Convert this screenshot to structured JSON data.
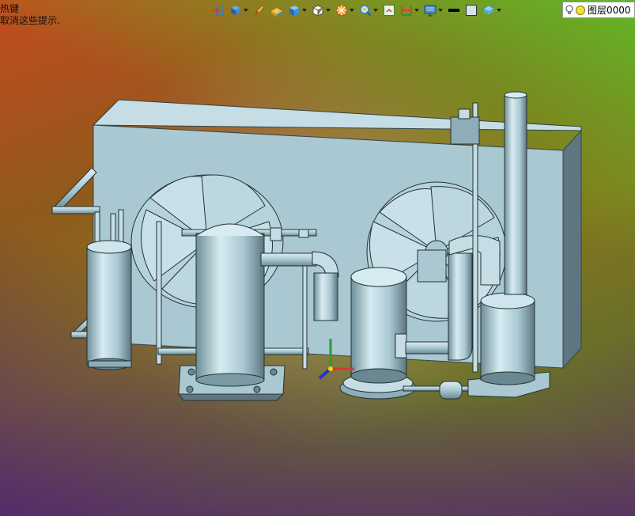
{
  "hint": {
    "line1": "热键",
    "line2": "取消这些提示."
  },
  "toolbar": {
    "items": [
      {
        "icon": "exit-sketch-icon",
        "caret": false
      },
      {
        "icon": "view-orient-icon",
        "caret": true
      },
      {
        "icon": "pencil-icon",
        "caret": false
      },
      {
        "icon": "shaded-box-icon",
        "caret": false
      },
      {
        "icon": "solid-cube-icon",
        "caret": true
      },
      {
        "icon": "wire-cube-icon",
        "caret": true
      },
      {
        "icon": "section-view-icon",
        "caret": true
      },
      {
        "icon": "zoom-fit-icon",
        "caret": true
      },
      {
        "icon": "grid-snap-icon",
        "caret": false
      },
      {
        "icon": "dimension-icon",
        "caret": true
      },
      {
        "icon": "display-monitor-icon",
        "caret": true
      },
      {
        "icon": "line-weight-icon",
        "caret": false
      },
      {
        "icon": "color-square-icon",
        "caret": false
      },
      {
        "icon": "layer-stack-icon",
        "caret": true
      }
    ]
  },
  "layer": {
    "label": "图层0000"
  },
  "colors": {
    "model_face": "#a9c8d2",
    "model_shadow": "#5f7680",
    "toolbar_accent": "#2a7fd6"
  }
}
